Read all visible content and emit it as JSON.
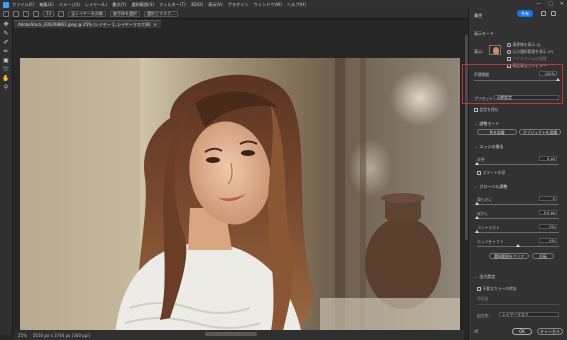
{
  "menubar": {
    "items": [
      "ファイル(F)",
      "編集(E)",
      "イメージ(I)",
      "レイヤー(L)",
      "書式(Y)",
      "選択範囲(S)",
      "フィルター(T)",
      "3D(D)",
      "表示(V)",
      "プラグイン",
      "ウィンドウ(W)",
      "ヘルプ(H)"
    ],
    "win_controls": [
      "—",
      "□",
      "✕"
    ]
  },
  "optbar": {
    "size": "13",
    "sample_all": "全レイヤーを対象",
    "subject": "被写体を選択",
    "select_mask": "選択とマスク..."
  },
  "document": {
    "tab_title": "AdobeStock_436298861.jpeg @ 25% (レイヤー 1, レイヤーマスク/8)",
    "close": "×"
  },
  "status": {
    "zoom": "25%",
    "dims": "5616 px x 3744 px (300 ppi)"
  },
  "panel": {
    "title": "属性",
    "share": "共有",
    "view_mode_hdr": "表示モード",
    "view_label": "表示：",
    "show_edges": "境界線を表示 (J)",
    "show_original": "元の選択範囲を表示 (P)",
    "realtime": "リアルタイムの調整",
    "hq_preview": "高品質なプレビュー",
    "opacity_label": "不透明度",
    "opacity_val": "100%",
    "preset_label": "プリセット：",
    "preset_val": "初期設定",
    "remember": "設定を保存",
    "refine_mode_hdr": "調整モード",
    "refine_color": "色を認識",
    "refine_object": "オブジェクトを認識",
    "edge_hdr": "エッジの検出",
    "radius_label": "半径",
    "radius_val": "0 px",
    "smart_radius": "スマート半径",
    "global_hdr": "グローバル調整",
    "smooth_label": "滑らかに",
    "smooth_val": "0",
    "feather_label": "ぼかし",
    "feather_val": "0.0 px",
    "contrast_label": "コントラスト",
    "contrast_val": "0%",
    "shift_label": "エッジをシフト",
    "shift_val": "0%",
    "clear_selection": "選択範囲をクリア",
    "invert": "反転",
    "output_hdr": "出力設定",
    "decontam": "不要なカラーの除去",
    "amount_label": "適用量",
    "output_label": "出力先：",
    "output_val": "レイヤーマスク",
    "ok": "OK",
    "cancel": "キャンセル"
  }
}
